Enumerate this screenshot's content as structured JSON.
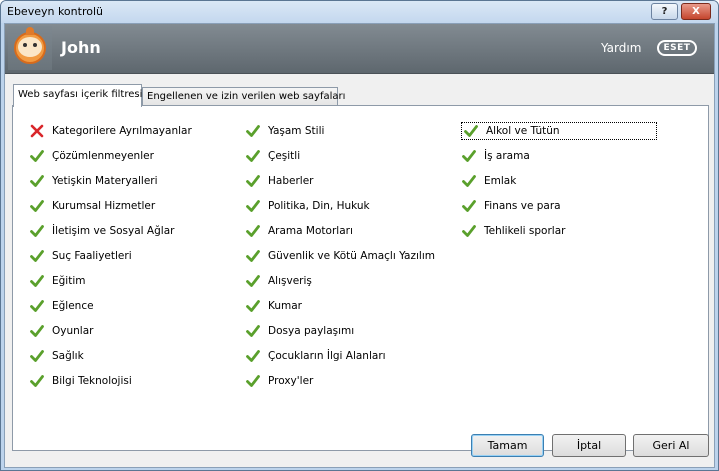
{
  "window": {
    "title": "Ebeveyn kontrolü"
  },
  "titlebar": {
    "help_label": "?",
    "close_label": "X"
  },
  "header": {
    "user_name": "John",
    "help_link": "Yardım",
    "logo_text": "ESET"
  },
  "tabs": [
    {
      "label": "Web sayfası içerik filtresi",
      "active": true
    },
    {
      "label": "Engellenen ve izin verilen web sayfaları",
      "active": false
    }
  ],
  "categories": {
    "column1": [
      {
        "label": "Kategorilere Ayrılmayanlar",
        "state": "blocked"
      },
      {
        "label": "Çözümlenmeyenler",
        "state": "allowed"
      },
      {
        "label": "Yetişkin Materyalleri",
        "state": "allowed"
      },
      {
        "label": "Kurumsal Hizmetler",
        "state": "allowed"
      },
      {
        "label": "İletişim ve Sosyal Ağlar",
        "state": "allowed"
      },
      {
        "label": "Suç Faaliyetleri",
        "state": "allowed"
      },
      {
        "label": "Eğitim",
        "state": "allowed"
      },
      {
        "label": "Eğlence",
        "state": "allowed"
      },
      {
        "label": "Oyunlar",
        "state": "allowed"
      },
      {
        "label": "Sağlık",
        "state": "allowed"
      },
      {
        "label": "Bilgi Teknolojisi",
        "state": "allowed"
      }
    ],
    "column2": [
      {
        "label": "Yaşam Stili",
        "state": "allowed"
      },
      {
        "label": "Çeşitli",
        "state": "allowed"
      },
      {
        "label": "Haberler",
        "state": "allowed"
      },
      {
        "label": "Politika, Din, Hukuk",
        "state": "allowed"
      },
      {
        "label": "Arama Motorları",
        "state": "allowed"
      },
      {
        "label": "Güvenlik ve Kötü Amaçlı Yazılım",
        "state": "allowed"
      },
      {
        "label": "Alışveriş",
        "state": "allowed"
      },
      {
        "label": "Kumar",
        "state": "allowed"
      },
      {
        "label": "Dosya paylaşımı",
        "state": "allowed"
      },
      {
        "label": "Çocukların İlgi Alanları",
        "state": "allowed"
      },
      {
        "label": "Proxy'ler",
        "state": "allowed"
      }
    ],
    "column3": [
      {
        "label": "Alkol ve Tütün",
        "state": "allowed",
        "focused": true
      },
      {
        "label": "İş arama",
        "state": "allowed"
      },
      {
        "label": "Emlak",
        "state": "allowed"
      },
      {
        "label": "Finans ve para",
        "state": "allowed"
      },
      {
        "label": "Tehlikeli sporlar",
        "state": "allowed"
      }
    ]
  },
  "icons": {
    "allowed": "checkmark-icon",
    "blocked": "cross-icon"
  },
  "colors": {
    "allowed": "#5aa02c",
    "blocked": "#d9262a",
    "header_bg": "#6f787f"
  },
  "buttons": {
    "ok": "Tamam",
    "cancel": "İptal",
    "revert": "Geri Al"
  }
}
